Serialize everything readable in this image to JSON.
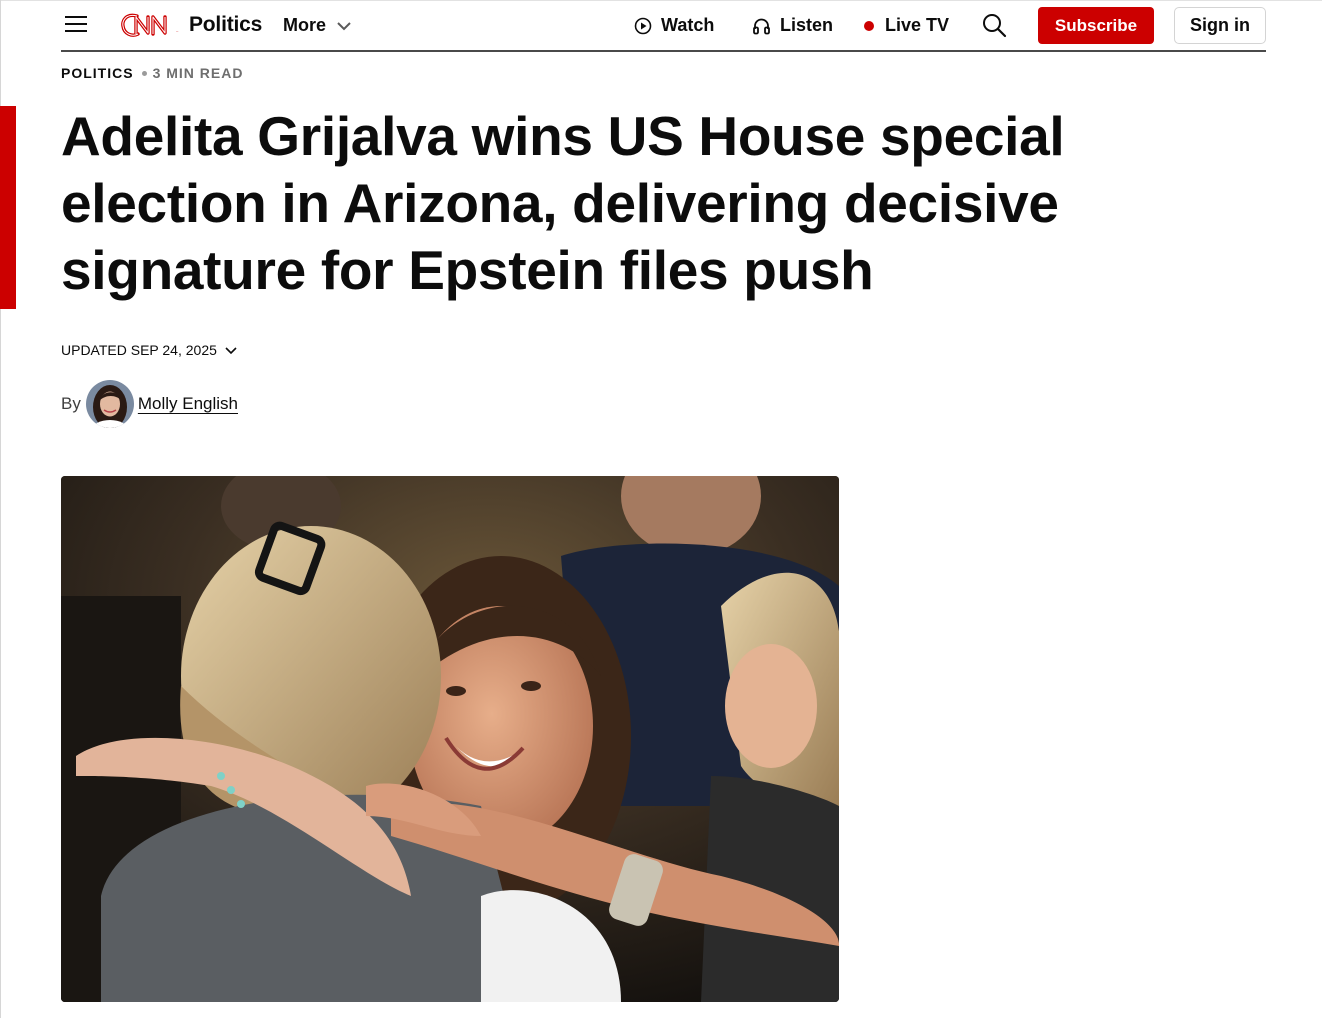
{
  "header": {
    "menu_icon": "hamburger-menu-icon",
    "logo": "CNN",
    "section": "Politics",
    "more_label": "More",
    "nav": {
      "watch": "Watch",
      "listen": "Listen",
      "live_tv": "Live TV"
    },
    "search_icon": "search-icon",
    "subscribe_label": "Subscribe",
    "signin_label": "Sign in",
    "brand_color": "#cc0000"
  },
  "article": {
    "section_label": "POLITICS",
    "read_time": "3 MIN READ",
    "headline": "Adelita Grijalva wins US House special election in Arizona, delivering decisive signature for Epstein files push",
    "updated": "UPDATED SEP 24, 2025",
    "byline_prefix": "By",
    "author": "Molly English"
  }
}
